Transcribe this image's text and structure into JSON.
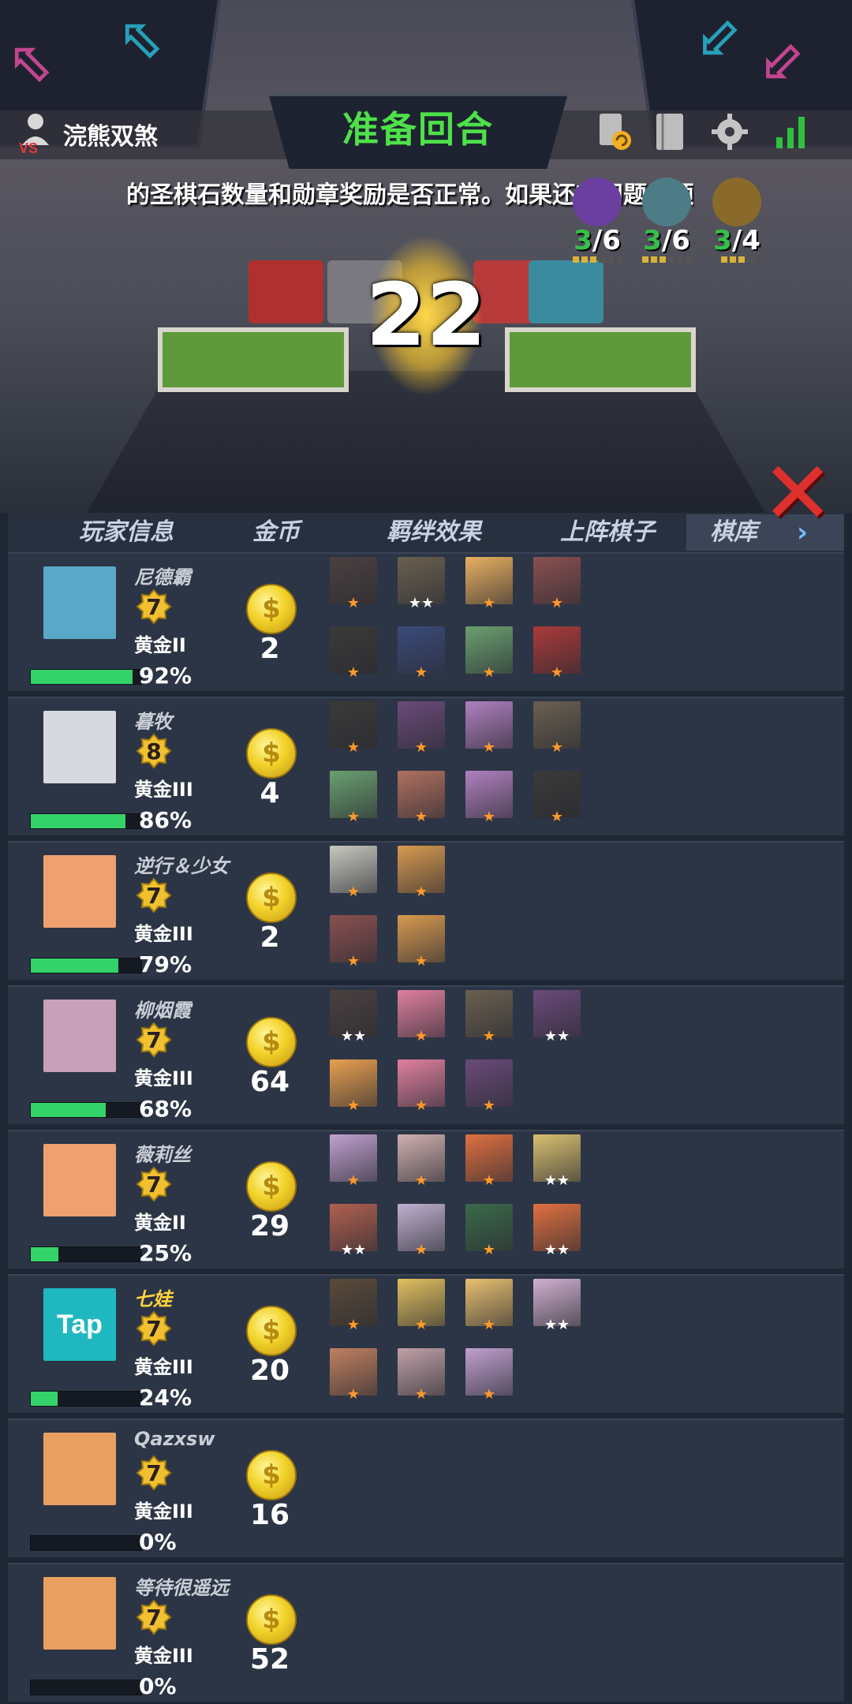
{
  "header": {
    "player_name": "浣熊双煞",
    "round_title": "准备回合",
    "countdown": "22",
    "marquee": "的圣棋石数量和勋章奖励是否正常。如果还有问题，烦请"
  },
  "traits": [
    {
      "active": "3",
      "total": "/6",
      "color": "#6b3fa0"
    },
    {
      "active": "3",
      "total": "/6",
      "color": "#4d7b86"
    },
    {
      "active": "3",
      "total": "/4",
      "color": "#8a6a2a"
    }
  ],
  "tabs": {
    "player_info": "玩家信息",
    "gold": "金币",
    "synergy": "羁绊效果",
    "board": "上阵棋子",
    "bench": "棋库",
    "bench_arrow": "›"
  },
  "coin_symbol": "$",
  "players": [
    {
      "name": "尼德霸",
      "level": "7",
      "rank": "黄金II",
      "hp": "92%",
      "hp_value": 0.92,
      "gold": "2",
      "avatar": "#5aa8c8",
      "highlight": false,
      "units_top": [
        {
          "c": "#4a4040",
          "s": "★",
          "t": "b"
        },
        {
          "c": "#6a6050",
          "s": "★★",
          "t": "s"
        },
        {
          "c": "#e8b060",
          "s": "★",
          "t": "b"
        },
        {
          "c": "#8a5050",
          "s": "★",
          "t": "b"
        }
      ],
      "units_bottom": [
        {
          "c": "#3a3a3a",
          "s": "★",
          "t": "b"
        },
        {
          "c": "#3a4a7a",
          "s": "★",
          "t": "b"
        },
        {
          "c": "#6aa070",
          "s": "★",
          "t": "b"
        },
        {
          "c": "#aa3a3a",
          "s": "★",
          "t": "b"
        }
      ]
    },
    {
      "name": "暮牧",
      "level": "8",
      "rank": "黄金III",
      "hp": "86%",
      "hp_value": 0.86,
      "gold": "4",
      "avatar": "#d8d8e0",
      "highlight": false,
      "units_top": [
        {
          "c": "#3a3a3a",
          "s": "★",
          "t": "b"
        },
        {
          "c": "#6a4a7a",
          "s": "★",
          "t": "b"
        },
        {
          "c": "#b080c0",
          "s": "★",
          "t": "b"
        },
        {
          "c": "#6a6050",
          "s": "★",
          "t": "b"
        }
      ],
      "units_bottom": [
        {
          "c": "#6aa070",
          "s": "★",
          "t": "b"
        },
        {
          "c": "#b07060",
          "s": "★",
          "t": "b"
        },
        {
          "c": "#b080c0",
          "s": "★",
          "t": "b"
        },
        {
          "c": "#3a3a3a",
          "s": "★",
          "t": "b"
        }
      ]
    },
    {
      "name": "逆行＆少女",
      "level": "7",
      "rank": "黄金III",
      "hp": "79%",
      "hp_value": 0.79,
      "gold": "2",
      "avatar": "#f0a070",
      "highlight": false,
      "units_top": [
        {
          "c": "#c8c8c0",
          "s": "★",
          "t": "b"
        },
        {
          "c": "#d89a50",
          "s": "★",
          "t": "b"
        }
      ],
      "units_bottom": [
        {
          "c": "#8a5050",
          "s": "★",
          "t": "b"
        },
        {
          "c": "#d89a50",
          "s": "★",
          "t": "b"
        }
      ]
    },
    {
      "name": "柳烟霞",
      "level": "7",
      "rank": "黄金III",
      "hp": "68%",
      "hp_value": 0.68,
      "gold": "64",
      "avatar": "#c8a0b8",
      "highlight": false,
      "units_top": [
        {
          "c": "#4a4040",
          "s": "★★",
          "t": "s"
        },
        {
          "c": "#e080a0",
          "s": "★",
          "t": "b"
        },
        {
          "c": "#6a6050",
          "s": "★",
          "t": "b"
        },
        {
          "c": "#6a4a7a",
          "s": "★★",
          "t": "s"
        }
      ],
      "units_bottom": [
        {
          "c": "#e8a050",
          "s": "★",
          "t": "b"
        },
        {
          "c": "#e080a0",
          "s": "★",
          "t": "b"
        },
        {
          "c": "#6a4a7a",
          "s": "★",
          "t": "b"
        }
      ]
    },
    {
      "name": "薇莉丝",
      "level": "7",
      "rank": "黄金II",
      "hp": "25%",
      "hp_value": 0.25,
      "gold": "29",
      "avatar": "#f0a070",
      "highlight": false,
      "units_top": [
        {
          "c": "#c0a0d0",
          "s": "★",
          "t": "b"
        },
        {
          "c": "#d0b0b0",
          "s": "★",
          "t": "b"
        },
        {
          "c": "#e07040",
          "s": "★",
          "t": "b"
        },
        {
          "c": "#d8c070",
          "s": "★★",
          "t": "s"
        }
      ],
      "units_bottom": [
        {
          "c": "#b06050",
          "s": "★★",
          "t": "s"
        },
        {
          "c": "#c0b0d0",
          "s": "★",
          "t": "b"
        },
        {
          "c": "#3a6a4a",
          "s": "★",
          "t": "b"
        },
        {
          "c": "#e07040",
          "s": "★★",
          "t": "s"
        }
      ]
    },
    {
      "name": "七娃",
      "level": "7",
      "rank": "黄金III",
      "hp": "24%",
      "hp_value": 0.24,
      "gold": "20",
      "avatar": "#20b8c0",
      "highlight": true,
      "avatar_text": "Tap",
      "units_top": [
        {
          "c": "#5a4a3a",
          "s": "★",
          "t": "b"
        },
        {
          "c": "#e0c060",
          "s": "★",
          "t": "b"
        },
        {
          "c": "#e8c070",
          "s": "★",
          "t": "b"
        },
        {
          "c": "#d0b0d0",
          "s": "★★",
          "t": "s"
        }
      ],
      "units_bottom": [
        {
          "c": "#c08060",
          "s": "★",
          "t": "b"
        },
        {
          "c": "#c0a0a8",
          "s": "★",
          "t": "b"
        },
        {
          "c": "#c0a0d0",
          "s": "★",
          "t": "b"
        }
      ]
    },
    {
      "name": "Qazxsw",
      "level": "7",
      "rank": "黄金III",
      "hp": "0%",
      "hp_value": 0,
      "gold": "16",
      "avatar": "#e8a060",
      "highlight": false,
      "units_top": [],
      "units_bottom": []
    },
    {
      "name": "等待很遥远",
      "level": "7",
      "rank": "黄金III",
      "hp": "0%",
      "hp_value": 0,
      "gold": "52",
      "avatar": "#e8a060",
      "highlight": false,
      "units_top": [],
      "units_bottom": []
    }
  ]
}
